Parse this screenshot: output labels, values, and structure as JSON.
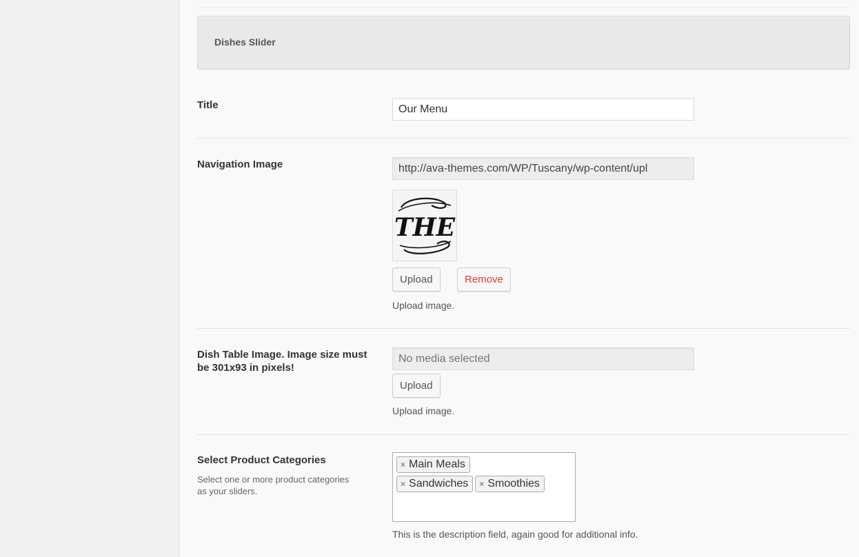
{
  "section": {
    "title": "Dishes Slider"
  },
  "fields": {
    "title": {
      "label": "Title",
      "value": "Our Menu"
    },
    "navigation_image": {
      "label": "Navigation Image",
      "value": "http://ava-themes.com/WP/Tuscany/wp-content/upl",
      "thumbnail_text": "THE",
      "upload_label": "Upload",
      "remove_label": "Remove",
      "help": "Upload image."
    },
    "dish_table_image": {
      "label": "Dish Table Image. Image size must be 301x93 in pixels!",
      "placeholder": "No media selected",
      "upload_label": "Upload",
      "help": "Upload image."
    },
    "product_categories": {
      "label": "Select Product Categories",
      "description": "Select one or more product categories as your sliders.",
      "selected": [
        "Main Meals",
        "Sandwiches",
        "Smoothies"
      ],
      "remove_symbol": "×",
      "help": "This is the description field, again good for additional info."
    }
  },
  "colors": {
    "remove": "#dd3d36",
    "header_bg": "#e9e9e9"
  }
}
